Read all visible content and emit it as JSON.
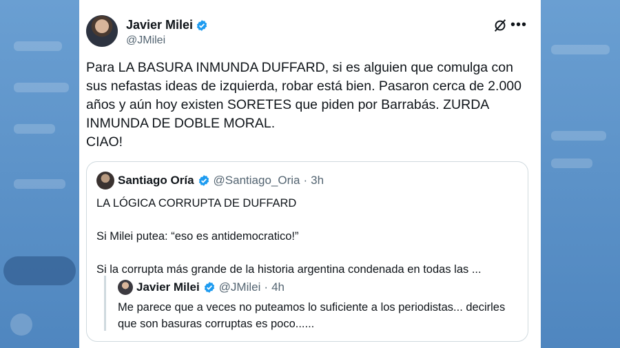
{
  "tweet": {
    "author_name": "Javier Milei",
    "author_handle": "@JMilei",
    "text": "Para LA BASURA INMUNDA DUFFARD, si es alguien que comulga con sus nefastas ideas de izquierda, robar está bien. Pasaron cerca de 2.000 años y aún hoy existen SORETES que piden por Barrabás. ZURDA INMUNDA DE DOBLE MORAL.\nCIAO!",
    "icons": {
      "grok": "grok-icon",
      "more": "more-options-icon",
      "verified": "verified-badge-icon"
    }
  },
  "quoted_tweet": {
    "author_name": "Santiago Oría",
    "author_handle": "@Santiago_Oria",
    "separator": "·",
    "time": "3h",
    "text": "LA LÓGICA CORRUPTA DE DUFFARD\n\nSi Milei putea: “eso es antidemocratico!”\n\nSi la corrupta más grande de la historia argentina condenada en todas las ..."
  },
  "nested_quote": {
    "author_name": "Javier Milei",
    "author_handle": "@JMilei",
    "separator": "·",
    "time": "4h",
    "text": "Me parece que a veces no puteamos lo suficiente a los periodistas... decirles que son basuras corruptas es poco......"
  },
  "colors": {
    "verified": "#1d9bf0",
    "secondary_text": "#536471",
    "border": "#cfd9de"
  }
}
